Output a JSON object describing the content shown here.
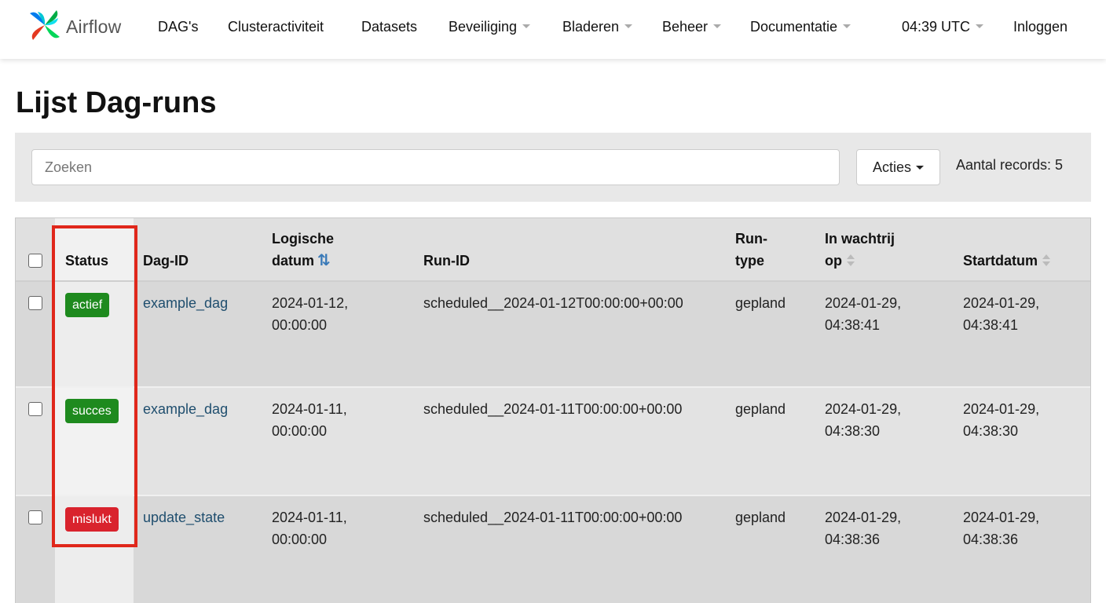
{
  "navbar": {
    "brand": "Airflow",
    "items": [
      {
        "label": "DAG's",
        "dropdown": false
      },
      {
        "label": "Clusteractiviteit",
        "dropdown": false
      },
      {
        "label": "Datasets",
        "dropdown": false
      },
      {
        "label": "Beveiliging",
        "dropdown": true
      },
      {
        "label": "Bladeren",
        "dropdown": true
      },
      {
        "label": "Beheer",
        "dropdown": true
      },
      {
        "label": "Documentatie",
        "dropdown": true
      }
    ],
    "time": "04:39 UTC",
    "login": "Inloggen"
  },
  "page": {
    "title": "Lijst Dag-runs"
  },
  "toolbar": {
    "search_placeholder": "Zoeken",
    "actions_label": "Acties",
    "records_label": "Aantal records: 5"
  },
  "table": {
    "headers": {
      "status": "Status",
      "dag_id": "Dag-ID",
      "logical_date_1": "Logische",
      "logical_date_2": "datum",
      "run_id": "Run-ID",
      "run_type_1": "Run-",
      "run_type_2": "type",
      "queued_at_1": "In wachtrij",
      "queued_at_2": "op",
      "start_date": "Startdatum"
    },
    "rows": [
      {
        "status": "actief",
        "status_color": "#1e8a1e",
        "dag_id": "example_dag",
        "logical_date_1": "2024-01-12,",
        "logical_date_2": "00:00:00",
        "run_id": "scheduled__2024-01-12T00:00:00+00:00",
        "run_type": "gepland",
        "queued_at_1": "2024-01-29,",
        "queued_at_2": "04:38:41",
        "start_date_1": "2024-01-29,",
        "start_date_2": "04:38:41"
      },
      {
        "status": "succes",
        "status_color": "#1e8a1e",
        "dag_id": "example_dag",
        "logical_date_1": "2024-01-11,",
        "logical_date_2": "00:00:00",
        "run_id": "scheduled__2024-01-11T00:00:00+00:00",
        "run_type": "gepland",
        "queued_at_1": "2024-01-29,",
        "queued_at_2": "04:38:30",
        "start_date_1": "2024-01-29,",
        "start_date_2": "04:38:30"
      },
      {
        "status": "mislukt",
        "status_color": "#d9232d",
        "dag_id": "update_state",
        "logical_date_1": "2024-01-11,",
        "logical_date_2": "00:00:00",
        "run_id": "scheduled__2024-01-11T00:00:00+00:00",
        "run_type": "gepland",
        "queued_at_1": "2024-01-29,",
        "queued_at_2": "04:38:36",
        "start_date_1": "2024-01-29,",
        "start_date_2": "04:38:36"
      }
    ]
  },
  "colors": {
    "highlight": "#e0271b",
    "link": "#1f4e6e",
    "sort_active": "#3a7ab8"
  }
}
